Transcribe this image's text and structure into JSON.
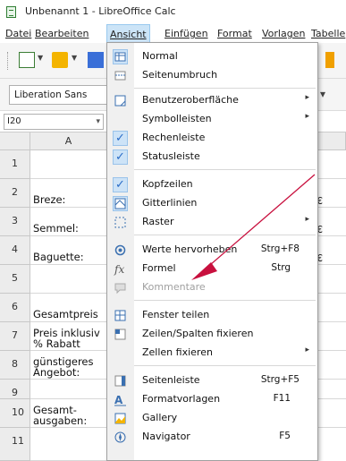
{
  "window": {
    "title": "Unbenannt 1 - LibreOffice Calc"
  },
  "menubar": {
    "items": [
      {
        "label": "Datei"
      },
      {
        "label": "Bearbeiten"
      },
      {
        "label": "Ansicht"
      },
      {
        "label": "Einfügen"
      },
      {
        "label": "Format"
      },
      {
        "label": "Vorlagen"
      },
      {
        "label": "Tabelle"
      }
    ]
  },
  "toolbar": {
    "font_name": "Liberation Sans",
    "font_dropdown_arrow": "▾"
  },
  "namebox": {
    "value": "I20",
    "arrow": "▾"
  },
  "grid": {
    "column_a": "A",
    "rows": [
      {
        "n": "1",
        "a": ""
      },
      {
        "n": "2",
        "a": "Breze:"
      },
      {
        "n": "3",
        "a": "Semmel:"
      },
      {
        "n": "4",
        "a": "Baguette:"
      },
      {
        "n": "5",
        "a": ""
      },
      {
        "n": "6",
        "a": "Gesamtpreis"
      },
      {
        "n": "7",
        "a": "Preis inklusiv\n% Rabatt"
      },
      {
        "n": "8",
        "a": "günstigeres\nAngebot:"
      },
      {
        "n": "9",
        "a": ""
      },
      {
        "n": "10",
        "a": "Gesamt-\nausgaben:"
      },
      {
        "n": "11",
        "a": ""
      }
    ],
    "euro": "€"
  },
  "menu": {
    "items": [
      {
        "label": "Normal",
        "icon": "normal-view-icon",
        "checked": true
      },
      {
        "label": "Seitenumbruch",
        "icon": "page-break-icon"
      },
      {
        "sep": true
      },
      {
        "label": "Benutzeroberfläche",
        "icon": "ui-icon",
        "submenu": true
      },
      {
        "label": "Symbolleisten",
        "submenu": true
      },
      {
        "label": "Rechenleiste",
        "checked": true
      },
      {
        "label": "Statusleiste",
        "checked": true
      },
      {
        "sep": true
      },
      {
        "label": "Kopfzeilen",
        "checked": true
      },
      {
        "label": "Gitterlinien",
        "icon": "gridlines-icon",
        "checked": true
      },
      {
        "label": "Raster",
        "icon": "raster-icon",
        "submenu": true
      },
      {
        "sep": true
      },
      {
        "label": "Werte hervorheben",
        "icon": "highlight-values-icon",
        "accel": "Strg+F8"
      },
      {
        "label": "Formel",
        "icon": "formula-icon",
        "accel": "Strg"
      },
      {
        "label": "Kommentare",
        "icon": "comments-icon",
        "disabled": true
      },
      {
        "sep": true
      },
      {
        "label": "Fenster teilen",
        "icon": "split-window-icon"
      },
      {
        "label": "Zeilen/Spalten fixieren",
        "icon": "freeze-icon"
      },
      {
        "label": "Zellen fixieren",
        "submenu": true
      },
      {
        "sep": true
      },
      {
        "label": "Seitenleiste",
        "icon": "sidebar-icon",
        "accel": "Strg+F5"
      },
      {
        "label": "Formatvorlagen",
        "icon": "styles-icon",
        "accel": "F11"
      },
      {
        "label": "Gallery",
        "icon": "gallery-icon"
      },
      {
        "label": "Navigator",
        "icon": "navigator-icon",
        "accel": "F5"
      }
    ]
  },
  "annotation": {
    "arrow_color": "#c8103e"
  }
}
